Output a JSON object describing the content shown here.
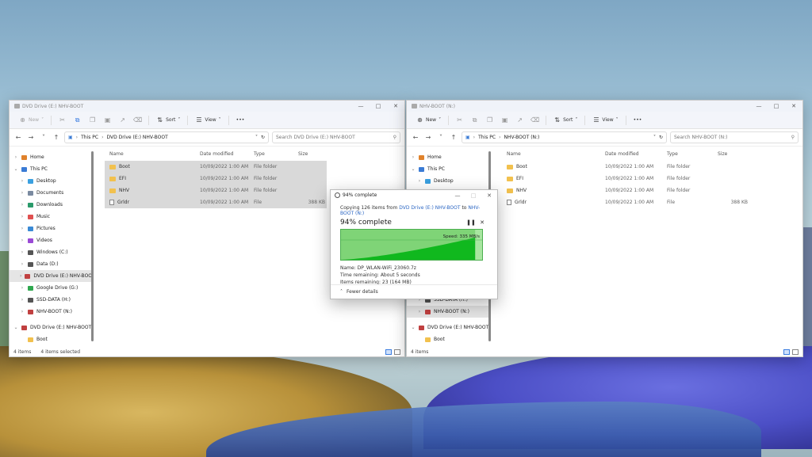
{
  "left_window": {
    "title": "DVD Drive (E:) NHV-BOOT",
    "toolbar": {
      "new_label": "New",
      "sort_label": "Sort",
      "view_label": "View",
      "more_label": "•••"
    },
    "address": {
      "segments": [
        "This PC",
        "DVD Drive (E:) NHV-BOOT"
      ]
    },
    "search_placeholder": "Search DVD Drive (E:) NHV-BOOT",
    "sidebar": [
      {
        "label": "Home",
        "arrow": "›",
        "icon": "home-icon",
        "color": "#e0822b",
        "indent": 0
      },
      {
        "label": "This PC",
        "arrow": "⌄",
        "icon": "pc-icon",
        "color": "#3a7bd5",
        "indent": 0
      },
      {
        "label": "Desktop",
        "arrow": "›",
        "icon": "desktop-icon",
        "color": "#3aa0e0",
        "indent": 1
      },
      {
        "label": "Documents",
        "arrow": "›",
        "icon": "documents-icon",
        "color": "#7a8aa0",
        "indent": 1
      },
      {
        "label": "Downloads",
        "arrow": "›",
        "icon": "downloads-icon",
        "color": "#2a9a6a",
        "indent": 1
      },
      {
        "label": "Music",
        "arrow": "›",
        "icon": "music-icon",
        "color": "#e05050",
        "indent": 1
      },
      {
        "label": "Pictures",
        "arrow": "›",
        "icon": "pictures-icon",
        "color": "#3a8ad5",
        "indent": 1
      },
      {
        "label": "Videos",
        "arrow": "›",
        "icon": "videos-icon",
        "color": "#9a4ad5",
        "indent": 1
      },
      {
        "label": "Windows (C:)",
        "arrow": "›",
        "icon": "drive-icon",
        "color": "#555555",
        "indent": 1
      },
      {
        "label": "Data (D:)",
        "arrow": "›",
        "icon": "drive-icon",
        "color": "#555555",
        "indent": 1
      },
      {
        "label": "DVD Drive (E:) NHV-BOOT",
        "arrow": "›",
        "icon": "dvd-icon",
        "color": "#c04040",
        "indent": 1,
        "selected": true
      },
      {
        "label": "Google Drive (G:)",
        "arrow": "›",
        "icon": "google-drive-icon",
        "color": "#2fa84f",
        "indent": 1
      },
      {
        "label": "SSD-DATA (H:)",
        "arrow": "›",
        "icon": "drive-icon",
        "color": "#555555",
        "indent": 1
      },
      {
        "label": "NHV-BOOT (N:)",
        "arrow": "›",
        "icon": "usb-icon",
        "color": "#c04040",
        "indent": 1
      },
      {
        "label": "DVD Drive (E:) NHV-BOOT",
        "arrow": "⌄",
        "icon": "dvd-icon",
        "color": "#c04040",
        "indent": 0
      },
      {
        "label": "Boot",
        "arrow": "",
        "icon": "folder-icon",
        "color": "#f2c14e",
        "indent": 1
      }
    ],
    "columns": [
      "Name",
      "Date modified",
      "Type",
      "Size"
    ],
    "rows": [
      {
        "name": "Boot",
        "date": "10/09/2022 1:00 AM",
        "type": "File folder",
        "size": "",
        "kind": "folder",
        "selected": true
      },
      {
        "name": "EFI",
        "date": "10/09/2022 1:00 AM",
        "type": "File folder",
        "size": "",
        "kind": "folder",
        "selected": true
      },
      {
        "name": "NHV",
        "date": "10/09/2022 1:00 AM",
        "type": "File folder",
        "size": "",
        "kind": "folder",
        "selected": true
      },
      {
        "name": "Grldr",
        "date": "10/09/2022 1:00 AM",
        "type": "File",
        "size": "388 KB",
        "kind": "file",
        "selected": true
      }
    ],
    "status": {
      "items": "4 items",
      "selected": "4 items selected"
    }
  },
  "right_window": {
    "title": "NHV-BOOT (N:)",
    "toolbar": {
      "new_label": "New",
      "sort_label": "Sort",
      "view_label": "View",
      "more_label": "•••"
    },
    "address": {
      "segments": [
        "This PC",
        "NHV-BOOT (N:)"
      ]
    },
    "search_placeholder": "Search NHV-BOOT (N:)",
    "sidebar": [
      {
        "label": "Home",
        "arrow": "›",
        "icon": "home-icon",
        "color": "#e0822b",
        "indent": 0
      },
      {
        "label": "This PC",
        "arrow": "⌄",
        "icon": "pc-icon",
        "color": "#3a7bd5",
        "indent": 0
      },
      {
        "label": "Desktop",
        "arrow": "›",
        "icon": "desktop-icon",
        "color": "#3aa0e0",
        "indent": 1
      },
      {
        "label": "",
        "arrow": "",
        "icon": "",
        "color": "",
        "indent": 1
      },
      {
        "label": "",
        "arrow": "",
        "icon": "",
        "color": "",
        "indent": 1
      },
      {
        "label": "",
        "arrow": "",
        "icon": "",
        "color": "",
        "indent": 1
      },
      {
        "label": "",
        "arrow": "",
        "icon": "",
        "color": "",
        "indent": 1
      },
      {
        "label": "",
        "arrow": "",
        "icon": "",
        "color": "",
        "indent": 1
      },
      {
        "label": "",
        "arrow": "",
        "icon": "",
        "color": "",
        "indent": 1
      },
      {
        "label": "",
        "arrow": "",
        "icon": "",
        "color": "",
        "indent": 1
      },
      {
        "label": "",
        "arrow": "",
        "icon": "",
        "color": "",
        "indent": 1
      },
      {
        "label": "",
        "arrow": "",
        "icon": "",
        "color": "",
        "indent": 1
      },
      {
        "label": "SSD-DATA (H:)",
        "arrow": "›",
        "icon": "drive-icon",
        "color": "#555555",
        "indent": 1
      },
      {
        "label": "NHV-BOOT (N:)",
        "arrow": "›",
        "icon": "usb-icon",
        "color": "#c04040",
        "indent": 1,
        "selected": true
      },
      {
        "label": "DVD Drive (E:) NHV-BOOT",
        "arrow": "⌄",
        "icon": "dvd-icon",
        "color": "#c04040",
        "indent": 0
      },
      {
        "label": "Boot",
        "arrow": "",
        "icon": "folder-icon",
        "color": "#f2c14e",
        "indent": 1
      }
    ],
    "columns": [
      "Name",
      "Date modified",
      "Type",
      "Size"
    ],
    "rows": [
      {
        "name": "Boot",
        "date": "10/09/2022 1:00 AM",
        "type": "File folder",
        "size": "",
        "kind": "folder",
        "selected": false
      },
      {
        "name": "EFI",
        "date": "10/09/2022 1:00 AM",
        "type": "File folder",
        "size": "",
        "kind": "folder",
        "selected": false
      },
      {
        "name": "NHV",
        "date": "10/09/2022 1:00 AM",
        "type": "File folder",
        "size": "",
        "kind": "folder",
        "selected": false
      },
      {
        "name": "Grldr",
        "date": "10/09/2022 1:00 AM",
        "type": "File",
        "size": "388 KB",
        "kind": "file",
        "selected": false
      }
    ],
    "status": {
      "items": "4 items",
      "selected": ""
    }
  },
  "copy_dialog": {
    "title": "94% complete",
    "copying_prefix": "Copying 126 items from",
    "source": "DVD Drive (E:) NHV-BOOT",
    "to_word": "to",
    "destination": "NHV-BOOT (N:)",
    "percent_label": "94% complete",
    "progress_fraction": 0.94,
    "speed": "Speed: 335 MB/s",
    "name_line": "Name:  DP_WLAN-WiFi_23060.7z",
    "time_line": "Time remaining:  About 5 seconds",
    "items_line": "Items remaining:  23 (164 MB)",
    "fewer_details": "Fewer details",
    "colors": {
      "fill": "#10b81e",
      "bg": "#a8e6a0",
      "border": "#4caf50"
    }
  }
}
